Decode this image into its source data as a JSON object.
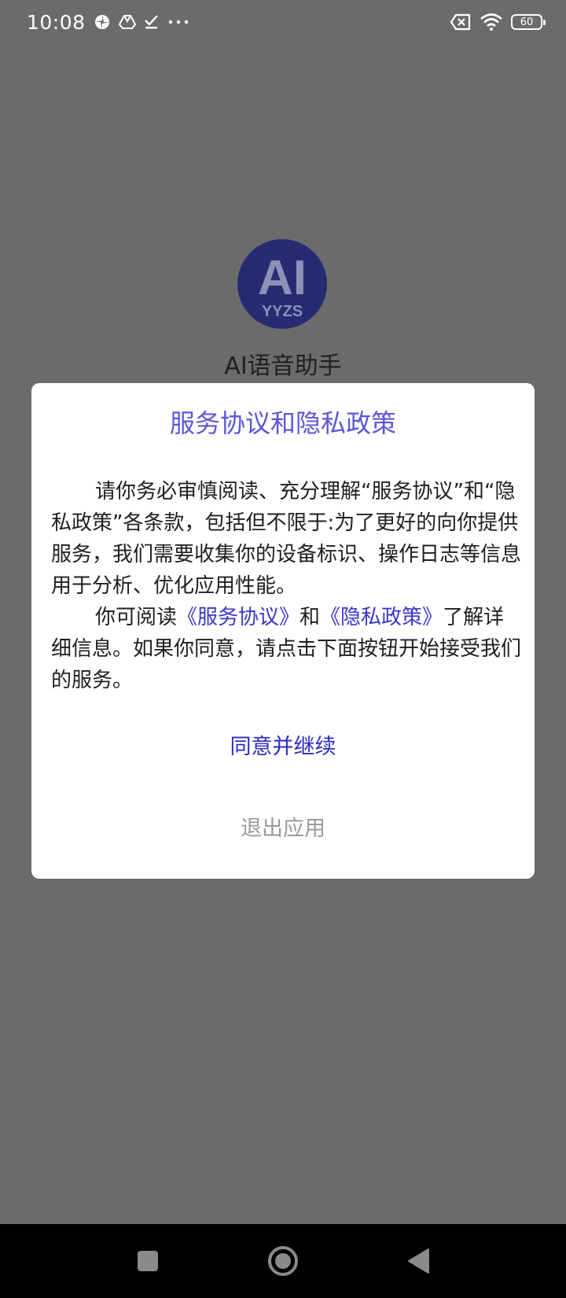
{
  "status_bar": {
    "time": "10:08",
    "battery_level": "60",
    "icons": [
      "pinwheel-icon",
      "drive-icon",
      "task-check-icon",
      "more-dots-icon",
      "sim-error-icon",
      "wifi-icon",
      "battery-icon"
    ]
  },
  "splash": {
    "logo_text": "AI",
    "logo_subtext": "YYZS",
    "app_name": "AI语音助手",
    "logo_color": "#272b72"
  },
  "dialog": {
    "title": "服务协议和隐私政策",
    "paragraph1": "请你务必审慎阅读、充分理解“服务协议”和“隐私政策”各条款，包括但不限于:为了更好的向你提供服务，我们需要收集你的设备标识、操作日志等信息用于分析、优化应用性能。",
    "paragraph2_prefix": "你可阅读",
    "link_service": "《服务协议》",
    "paragraph2_and": "和",
    "link_privacy": "《隐私政策》",
    "paragraph2_suffix": "了解详细信息。如果你同意，请点击下面按钮开始接受我们的服务。",
    "agree_button": "同意并继续",
    "exit_button": "退出应用",
    "title_color": "#5b56d8",
    "link_color": "#3a37c9"
  },
  "nav_bar": {
    "buttons": [
      "recent-apps-icon",
      "home-icon",
      "back-icon"
    ]
  }
}
